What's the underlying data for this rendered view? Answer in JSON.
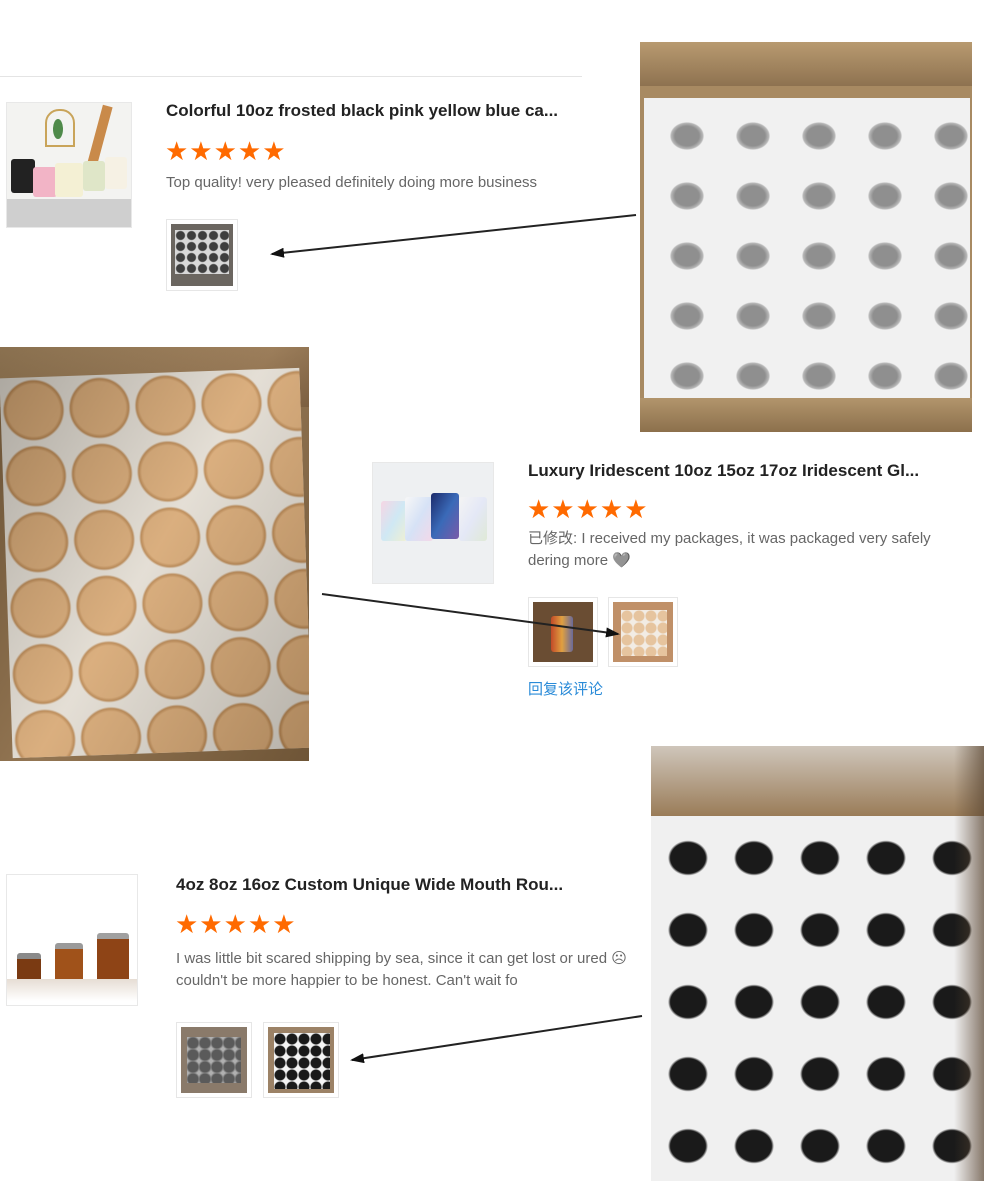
{
  "reviews": [
    {
      "title": "Colorful 10oz frosted black pink yellow blue ca...",
      "stars": "★★★★★",
      "text": "Top quality! very pleased definitely doing more business"
    },
    {
      "title": "Luxury Iridescent 10oz 15oz 17oz Iridescent Gl...",
      "stars": "★★★★★",
      "text": "已修改: I received my packages, it was packaged very safely dering more 🩶",
      "reply": "回复该评论"
    },
    {
      "title": "4oz 8oz 16oz Custom Unique Wide Mouth Rou...",
      "stars": "★★★★★",
      "text": "I was little bit scared shipping by sea, since it can get lost or ured ☹ couldn't be more happier to be honest. Can't wait fo"
    }
  ],
  "colors": {
    "accent_star": "#ff6a00",
    "link": "#2a8bd8"
  }
}
